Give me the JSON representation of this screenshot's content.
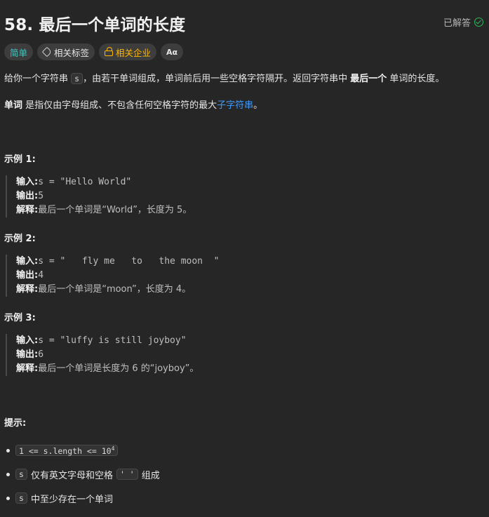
{
  "header": {
    "title": "58. 最后一个单词的长度",
    "status": "已解答"
  },
  "tags": {
    "difficulty": "简单",
    "related_tags": "相关标签",
    "related_companies": "相关企业",
    "translate": "Aα"
  },
  "description": {
    "p1_a": "给你一个字符串 ",
    "p1_code": "s",
    "p1_b": "，由若干单词组成，单词前后用一些空格字符隔开。返回字符串中 ",
    "p1_bold": "最后一个",
    "p1_c": " 单词的长度。",
    "p2_bold": "单词",
    "p2_a": " 是指仅由字母组成、不包含任何空格字符的最大",
    "p2_link": "子字符串",
    "p2_b": "。"
  },
  "examples": [
    {
      "title": "示例 1:",
      "input_label": "输入:",
      "input_value": "s = \"Hello World\"",
      "output_label": "输出:",
      "output_value": "5",
      "explain_label": "解释:",
      "explain_value": "最后一个单词是“World”，长度为 5。"
    },
    {
      "title": "示例 2:",
      "input_label": "输入:",
      "input_value": "s = \"   fly me   to   the moon  \"",
      "output_label": "输出:",
      "output_value": "4",
      "explain_label": "解释:",
      "explain_value": "最后一个单词是“moon”，长度为 4。"
    },
    {
      "title": "示例 3:",
      "input_label": "输入:",
      "input_value": "s = \"luffy is still joyboy\"",
      "output_label": "输出:",
      "output_value": "6",
      "explain_label": "解释:",
      "explain_value": "最后一个单词是长度为 6 的“joyboy”。"
    }
  ],
  "hints": {
    "title": "提示:",
    "h1_code": "1 <= s.length <= 10",
    "h1_sup": "4",
    "h2_code": "s",
    "h2_text": "仅有英文字母和空格",
    "h2_code2": "' '",
    "h2_text2": "组成",
    "h3_code": "s",
    "h3_text": "中至少存在一个单词"
  }
}
